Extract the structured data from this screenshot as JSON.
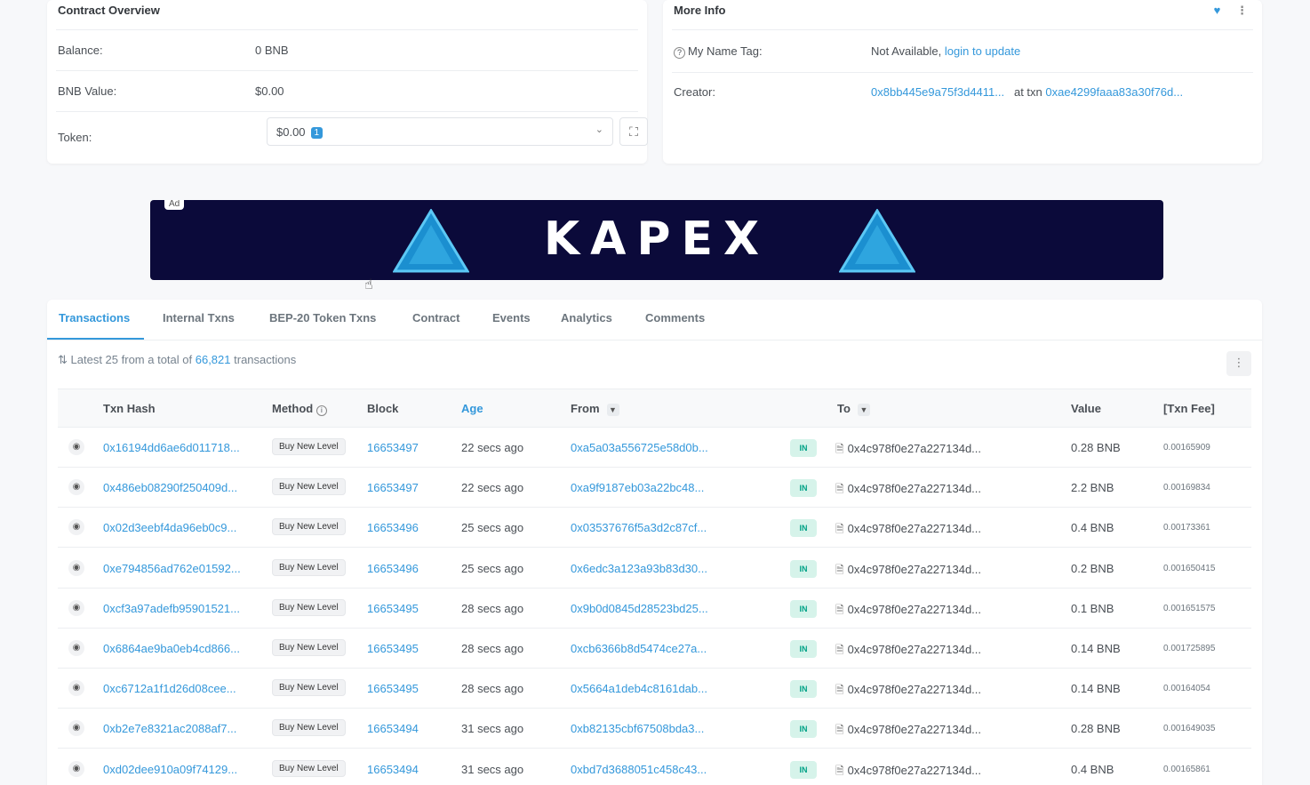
{
  "overview": {
    "title": "Contract Overview",
    "balance_label": "Balance:",
    "balance_value": "0 BNB",
    "bnb_value_label": "BNB Value:",
    "bnb_value": "$0.00",
    "token_label": "Token:",
    "token_value": "$0.00",
    "token_count": "1"
  },
  "more_info": {
    "title": "More Info",
    "name_tag_label": "My Name Tag:",
    "name_tag_value": "Not Available,",
    "name_tag_link": "login to update",
    "creator_label": "Creator:",
    "creator_address": "0x8bb445e9a75f3d4411...",
    "creator_at_txn": "at txn",
    "creator_txn": "0xae4299faaa83a30f76d..."
  },
  "ad": {
    "tag": "Ad",
    "text": "KAPEX"
  },
  "tabs": [
    "Transactions",
    "Internal Txns",
    "BEP-20 Token Txns",
    "Contract",
    "Events",
    "Analytics",
    "Comments"
  ],
  "summary": {
    "prefix": "Latest 25 from a total of",
    "count": "66,821",
    "suffix": "transactions"
  },
  "table": {
    "headers": {
      "hash": "Txn Hash",
      "method": "Method",
      "block": "Block",
      "age": "Age",
      "from": "From",
      "to": "To",
      "value": "Value",
      "fee": "[Txn Fee]"
    },
    "rows": [
      {
        "hash": "0x16194dd6ae6d011718...",
        "method": "Buy New Level",
        "block": "16653497",
        "age": "22 secs ago",
        "from": "0xa5a03a556725e58d0b...",
        "dir": "IN",
        "to": "0x4c978f0e27a227134d...",
        "value": "0.28 BNB",
        "fee": "0.00165909"
      },
      {
        "hash": "0x486eb08290f250409d...",
        "method": "Buy New Level",
        "block": "16653497",
        "age": "22 secs ago",
        "from": "0xa9f9187eb03a22bc48...",
        "dir": "IN",
        "to": "0x4c978f0e27a227134d...",
        "value": "2.2 BNB",
        "fee": "0.00169834"
      },
      {
        "hash": "0x02d3eebf4da96eb0c9...",
        "method": "Buy New Level",
        "block": "16653496",
        "age": "25 secs ago",
        "from": "0x03537676f5a3d2c87cf...",
        "dir": "IN",
        "to": "0x4c978f0e27a227134d...",
        "value": "0.4 BNB",
        "fee": "0.00173361"
      },
      {
        "hash": "0xe794856ad762e01592...",
        "method": "Buy New Level",
        "block": "16653496",
        "age": "25 secs ago",
        "from": "0x6edc3a123a93b83d30...",
        "dir": "IN",
        "to": "0x4c978f0e27a227134d...",
        "value": "0.2 BNB",
        "fee": "0.001650415"
      },
      {
        "hash": "0xcf3a97adefb95901521...",
        "method": "Buy New Level",
        "block": "16653495",
        "age": "28 secs ago",
        "from": "0x9b0d0845d28523bd25...",
        "dir": "IN",
        "to": "0x4c978f0e27a227134d...",
        "value": "0.1 BNB",
        "fee": "0.001651575"
      },
      {
        "hash": "0x6864ae9ba0eb4cd866...",
        "method": "Buy New Level",
        "block": "16653495",
        "age": "28 secs ago",
        "from": "0xcb6366b8d5474ce27a...",
        "dir": "IN",
        "to": "0x4c978f0e27a227134d...",
        "value": "0.14 BNB",
        "fee": "0.001725895"
      },
      {
        "hash": "0xc6712a1f1d26d08cee...",
        "method": "Buy New Level",
        "block": "16653495",
        "age": "28 secs ago",
        "from": "0x5664a1deb4c8161dab...",
        "dir": "IN",
        "to": "0x4c978f0e27a227134d...",
        "value": "0.14 BNB",
        "fee": "0.00164054"
      },
      {
        "hash": "0xb2e7e8321ac2088af7...",
        "method": "Buy New Level",
        "block": "16653494",
        "age": "31 secs ago",
        "from": "0xb82135cbf67508bda3...",
        "dir": "IN",
        "to": "0x4c978f0e27a227134d...",
        "value": "0.28 BNB",
        "fee": "0.001649035"
      },
      {
        "hash": "0xd02dee910a09f74129...",
        "method": "Buy New Level",
        "block": "16653494",
        "age": "31 secs ago",
        "from": "0xbd7d3688051c458c43...",
        "dir": "IN",
        "to": "0x4c978f0e27a227134d...",
        "value": "0.4 BNB",
        "fee": "0.00165861"
      }
    ]
  }
}
